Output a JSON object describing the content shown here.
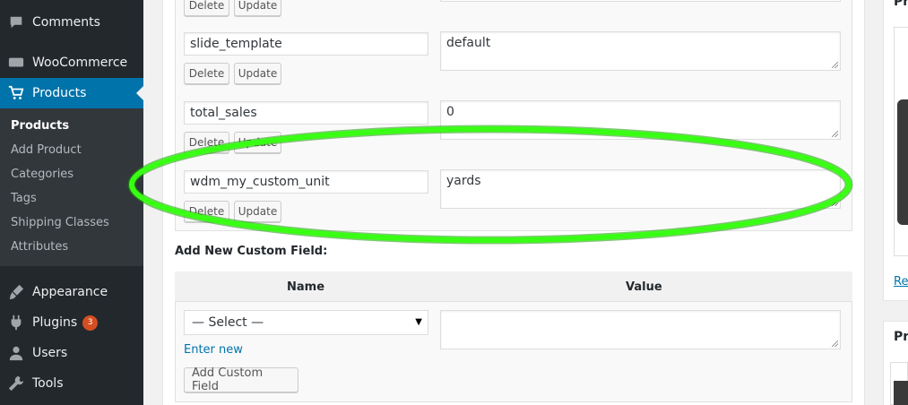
{
  "sidebar": {
    "menu": [
      {
        "label": "Comments",
        "icon": "comment-icon"
      },
      {
        "label": "WooCommerce",
        "icon": "woocommerce-icon"
      },
      {
        "label": "Products",
        "icon": "cart-icon"
      },
      {
        "label": "Appearance",
        "icon": "brush-icon"
      },
      {
        "label": "Plugins",
        "icon": "plugin-icon",
        "badge": "3"
      },
      {
        "label": "Users",
        "icon": "user-icon"
      },
      {
        "label": "Tools",
        "icon": "wrench-icon"
      }
    ],
    "submenu": [
      "Products",
      "Add Product",
      "Categories",
      "Tags",
      "Shipping Classes",
      "Attributes"
    ]
  },
  "custom_fields": {
    "rows": [
      {
        "key": "",
        "value": ""
      },
      {
        "key": "slide_template",
        "value": "default"
      },
      {
        "key": "total_sales",
        "value": "0"
      },
      {
        "key": "wdm_my_custom_unit",
        "value": "yards"
      }
    ],
    "delete_label": "Delete",
    "update_label": "Update"
  },
  "add_new": {
    "title": "Add New Custom Field:",
    "col_name": "Name",
    "col_value": "Value",
    "select_value": "— Select —",
    "enter_new": "Enter new",
    "add_button": "Add Custom Field"
  },
  "right_column": {
    "widget1_title": "Pr",
    "widget1_link": "Re",
    "widget2_title": "Pro"
  },
  "colors": {
    "accent": "#0073aa",
    "sidebar": "#23282d",
    "highlight": "#39ff14",
    "badge": "#d54e21"
  }
}
